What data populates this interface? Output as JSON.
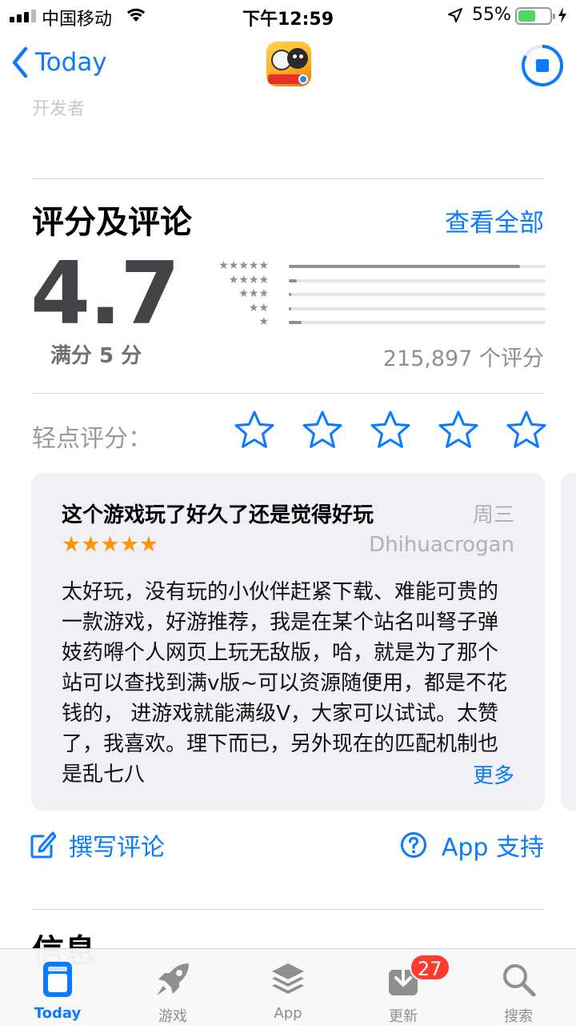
{
  "status_bar": {
    "carrier": "中国移动",
    "time": "下午12:59",
    "battery_percent": "55%",
    "battery_level": 0.55,
    "battery_color": "#4cd964"
  },
  "nav": {
    "back_label": "Today",
    "app_icon": "game-app-icon",
    "download_icon": "stop-download-icon"
  },
  "faded_header": "开发者",
  "ratings": {
    "title": "评分及评论",
    "see_all": "查看全部",
    "average": "4.7",
    "out_of": "满分 5 分",
    "distribution": [
      {
        "stars": 5,
        "label": "★★★★★",
        "fraction": 0.9
      },
      {
        "stars": 4,
        "label": "★★★★",
        "fraction": 0.03
      },
      {
        "stars": 3,
        "label": "★★★",
        "fraction": 0.01
      },
      {
        "stars": 2,
        "label": "★★",
        "fraction": 0.005
      },
      {
        "stars": 1,
        "label": "★",
        "fraction": 0.05
      }
    ],
    "count": "215,897 个评分"
  },
  "tap_to_rate": {
    "label": "轻点评分：",
    "stars": 5
  },
  "review": {
    "title": "这个游戏玩了好久了还是觉得好玩",
    "date": "周三",
    "rating": 5,
    "stars_text": "★★★★★",
    "author": "Dhihuacrogan",
    "body": "太好玩，没有玩的小伙伴赶紧下载、难能可贵的一款游戏，好游推荐，我是在某个站名叫弩子弹妓药嘚个人网页上玩无敌版，哈，就是为了那个站可以查找到满v版~可以资源随便用，都是不花钱的， 进游戏就能满级V，大家可以试试。太赞了，我喜欢。理下而已，另外现在的匹配机制也是乱七八",
    "more": "更多"
  },
  "actions": {
    "write_review": "撰写评论",
    "app_support": "App 支持"
  },
  "info_heading": "信息",
  "tab_bar": {
    "tabs": [
      {
        "label": "Today",
        "icon": "today-icon",
        "active": true
      },
      {
        "label": "游戏",
        "icon": "rocket-icon",
        "active": false
      },
      {
        "label": "App",
        "icon": "layers-icon",
        "active": false
      },
      {
        "label": "更新",
        "icon": "download-tray-icon",
        "active": false
      },
      {
        "label": "搜索",
        "icon": "search-icon",
        "active": false
      }
    ],
    "updates_badge": "27"
  },
  "colors": {
    "accent": "#0a7aff",
    "review_star": "#ff9500",
    "badge": "#ff3b30",
    "card_bg": "#f0f0f5"
  }
}
